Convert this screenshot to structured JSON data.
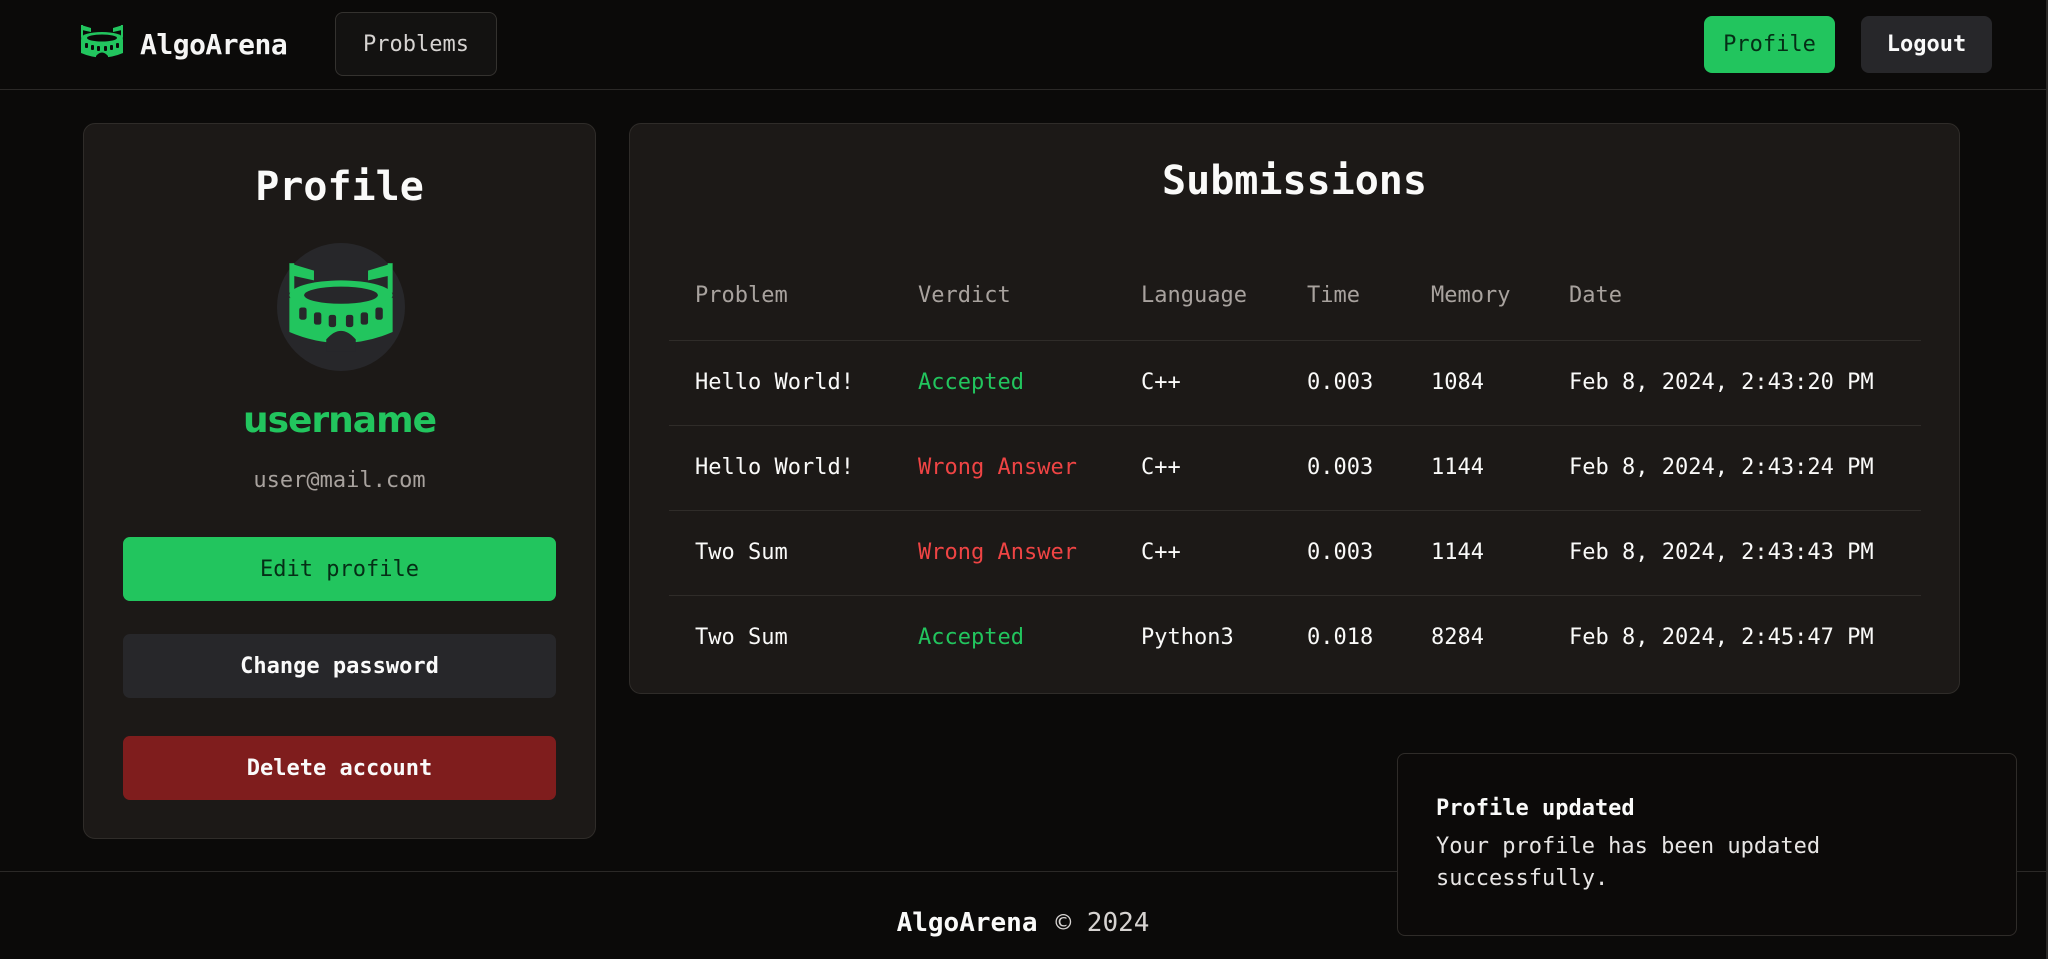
{
  "navbar": {
    "brand_name": "AlgoArena",
    "problems_label": "Problems",
    "profile_label": "Profile",
    "logout_label": "Logout"
  },
  "profile": {
    "title": "Profile",
    "username": "username",
    "email": "user@mail.com",
    "edit_label": "Edit profile",
    "change_password_label": "Change password",
    "delete_label": "Delete account"
  },
  "submissions": {
    "title": "Submissions",
    "headers": [
      "Problem",
      "Verdict",
      "Language",
      "Time",
      "Memory",
      "Date"
    ],
    "rows": [
      {
        "problem": "Hello World!",
        "verdict": "Accepted",
        "language": "C++",
        "time": "0.003",
        "memory": "1084",
        "date": "Feb 8, 2024, 2:43:20 PM"
      },
      {
        "problem": "Hello World!",
        "verdict": "Wrong Answer",
        "language": "C++",
        "time": "0.003",
        "memory": "1144",
        "date": "Feb 8, 2024, 2:43:24 PM"
      },
      {
        "problem": "Two Sum",
        "verdict": "Wrong Answer",
        "language": "C++",
        "time": "0.003",
        "memory": "1144",
        "date": "Feb 8, 2024, 2:43:43 PM"
      },
      {
        "problem": "Two Sum",
        "verdict": "Accepted",
        "language": "Python3",
        "time": "0.018",
        "memory": "8284",
        "date": "Feb 8, 2024, 2:45:47 PM"
      }
    ]
  },
  "footer": {
    "brand": "AlgoArena",
    "copyright": "© 2024"
  },
  "toast": {
    "title": "Profile updated",
    "message": "Your profile has been updated successfully."
  },
  "colors": {
    "accent": "#22c55e",
    "danger": "#ef4444",
    "delete_bg": "#7f1d1d",
    "card_bg": "#1c1917",
    "page_bg": "#0b0a09"
  },
  "icons": {
    "brand_logo": "stadium-icon",
    "avatar": "stadium-icon"
  }
}
